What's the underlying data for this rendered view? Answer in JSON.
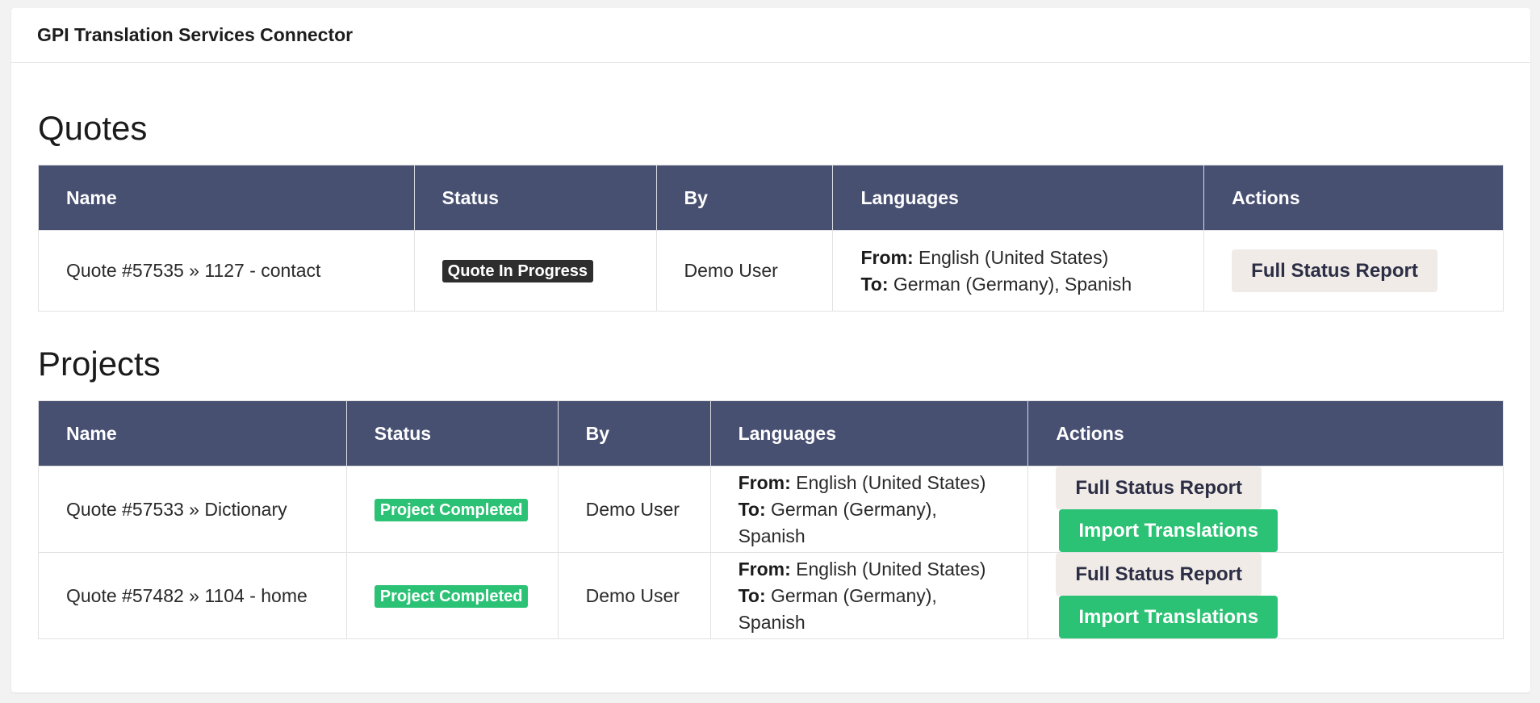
{
  "app": {
    "title": "GPI Translation Services Connector"
  },
  "quotes": {
    "title": "Quotes",
    "headers": {
      "name": "Name",
      "status": "Status",
      "by": "By",
      "languages": "Languages",
      "actions": "Actions"
    },
    "rows": [
      {
        "name": "Quote #57535 » 1127 - contact",
        "status": "Quote In Progress",
        "by": "Demo User",
        "from_label": "From:",
        "from": "English (United States)",
        "to_label": "To:",
        "to": "German (Germany), Spanish",
        "report_button": "Full Status Report"
      }
    ]
  },
  "projects": {
    "title": "Projects",
    "headers": {
      "name": "Name",
      "status": "Status",
      "by": "By",
      "languages": "Languages",
      "actions": "Actions"
    },
    "rows": [
      {
        "name": "Quote #57533 » Dictionary",
        "status": "Project Completed",
        "by": "Demo User",
        "from_label": "From:",
        "from": "English (United States)",
        "to_label": "To:",
        "to": "German (Germany), Spanish",
        "report_button": "Full Status Report",
        "import_button": "Import Translations"
      },
      {
        "name": "Quote #57482 » 1104 - home",
        "status": "Project Completed",
        "by": "Demo User",
        "from_label": "From:",
        "from": "English (United States)",
        "to_label": "To:",
        "to": "German (Germany), Spanish",
        "report_button": "Full Status Report",
        "import_button": "Import Translations"
      }
    ]
  },
  "colors": {
    "header_bg": "#485072",
    "success_green": "#2cc275",
    "badge_dark": "#2e2e2e",
    "button_light": "#f1ebe8"
  }
}
